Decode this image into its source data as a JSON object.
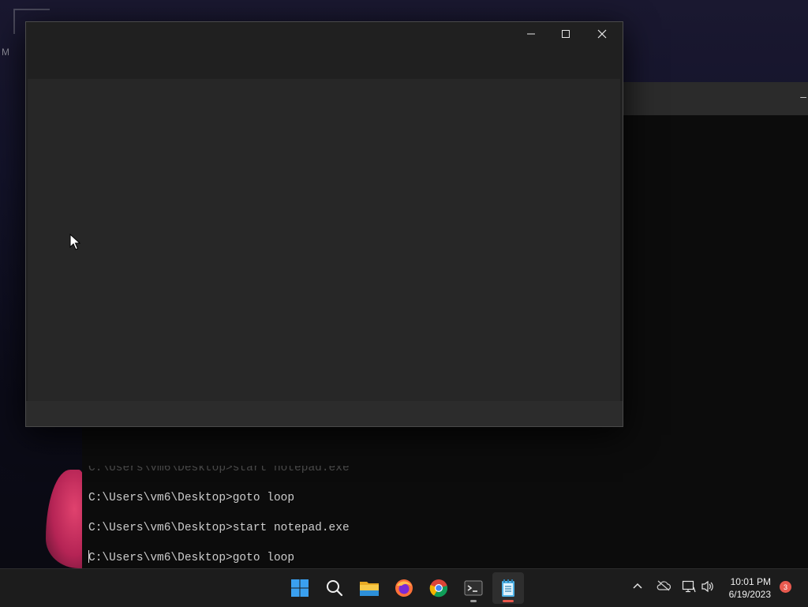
{
  "desktop": {
    "icon_label": "M"
  },
  "terminal": {
    "minimize_glyph": "–",
    "faded_line": "C:\\Users\\vm6\\Desktop>start notepad.exe",
    "lines": [
      "C:\\Users\\vm6\\Desktop>goto loop",
      "C:\\Users\\vm6\\Desktop>start notepad.exe",
      "C:\\Users\\vm6\\Desktop>goto loop"
    ]
  },
  "notepad": {
    "title": "",
    "content": ""
  },
  "taskbar": {
    "apps": [
      "start-icon",
      "search-icon",
      "file-explorer-icon",
      "firefox-icon",
      "chrome-icon",
      "terminal-icon",
      "notepad-icon"
    ],
    "time": "10:01 PM",
    "date": "6/19/2023",
    "notification_count": "3"
  },
  "colors": {
    "taskbar": "#1c1c1c",
    "notepad_bg": "#272727",
    "terminal_bg": "#0c0c0c",
    "accent": "#0078d4",
    "notification_badge": "#e85a4f"
  }
}
